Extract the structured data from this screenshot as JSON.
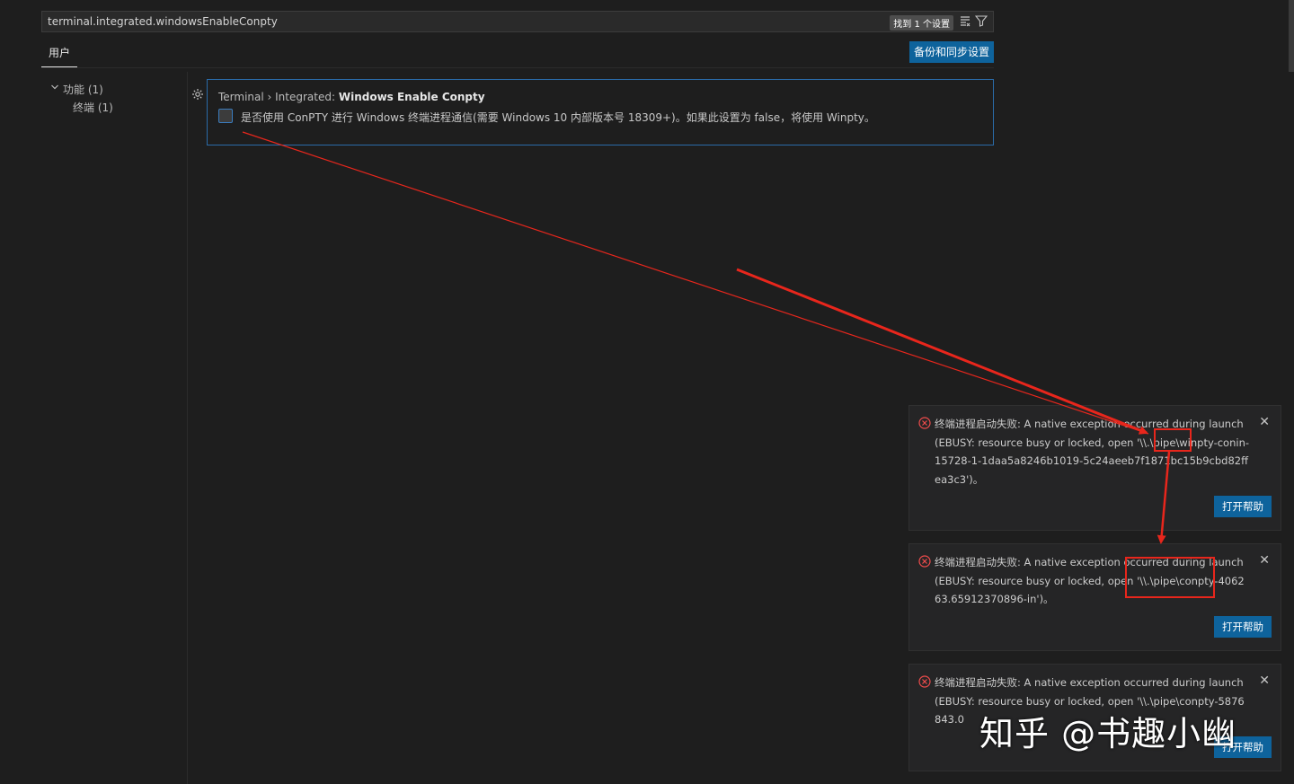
{
  "search": {
    "value": "terminal.integrated.windowsEnableConpty",
    "result_badge": "找到 1 个设置",
    "icons": [
      "clear-filter-icon",
      "filter-icon"
    ]
  },
  "header": {
    "tab_user": "用户",
    "sync_button": "备份和同步设置"
  },
  "toc": {
    "items": [
      {
        "label": "功能 (1)",
        "expanded": true
      },
      {
        "label": "终端 (1)"
      }
    ]
  },
  "setting": {
    "title_prefix": "Terminal › Integrated: ",
    "title_name": "Windows Enable Conpty",
    "checked": false,
    "description": "是否使用 ConPTY 进行 Windows 终端进程通信(需要 Windows 10 内部版本号 18309+)。如果此设置为 false，将使用 Winpty。"
  },
  "notifications": [
    {
      "message": "终端进程启动失败: A native exception occurred during launch (EBUSY: resource busy or locked, open '\\\\.\\pipe\\winpty-conin-15728-1-1daa5a8246b1019-5c24aeeb7f1871bc15b9cbd82ffea3c3')。",
      "button": "打开帮助"
    },
    {
      "message": "终端进程启动失败: A native exception occurred during launch (EBUSY: resource busy or locked, open '\\\\.\\pipe\\conpty-406263.65912370896-in')。",
      "button": "打开帮助"
    },
    {
      "message": "终端进程启动失败: A native exception occurred during launch (EBUSY: resource busy or locked, open '\\\\.\\pipe\\conpty-5876843.0",
      "button": "打开帮助"
    }
  ],
  "watermark": "知乎 @书趣小幽",
  "colors": {
    "annotation": "#e8261c",
    "accent": "#0e639c",
    "error": "#f14c4c"
  }
}
